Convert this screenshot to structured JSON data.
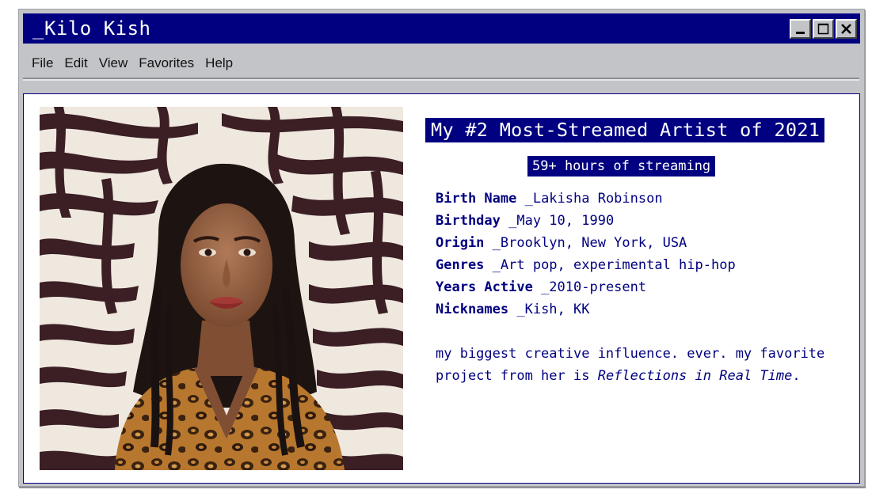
{
  "window": {
    "title": "_Kilo Kish",
    "controls": [
      "minimize-icon",
      "maximize-icon",
      "close-icon"
    ]
  },
  "menu": {
    "items": [
      {
        "label": "File"
      },
      {
        "label": "Edit"
      },
      {
        "label": "View"
      },
      {
        "label": "Favorites"
      },
      {
        "label": "Help"
      }
    ]
  },
  "content": {
    "photo_alt": "Portrait photo against zebra-print backdrop",
    "heading": "My #2 Most-Streamed Artist of 2021",
    "subheading": "59+ hours of streaming",
    "facts": [
      {
        "label": "Birth Name",
        "value": " _Lakisha Robinson"
      },
      {
        "label": "Birthday",
        "value": " _May 10, 1990"
      },
      {
        "label": "Origin",
        "value": " _Brooklyn, New York, USA"
      },
      {
        "label": "Genres",
        "value": " _Art pop, experimental hip-hop"
      },
      {
        "label": "Years Active",
        "value": " _2010-present"
      },
      {
        "label": "Nicknames",
        "value": " _Kish, KK"
      }
    ],
    "blurb": {
      "text": "my biggest creative influence. ever. my favorite project from her is ",
      "emphasis": "Reflections in Real Time",
      "end": "."
    }
  },
  "colors": {
    "title_bar": "#000080",
    "accent_text": "#000080",
    "chrome": "#c3c4c8"
  }
}
